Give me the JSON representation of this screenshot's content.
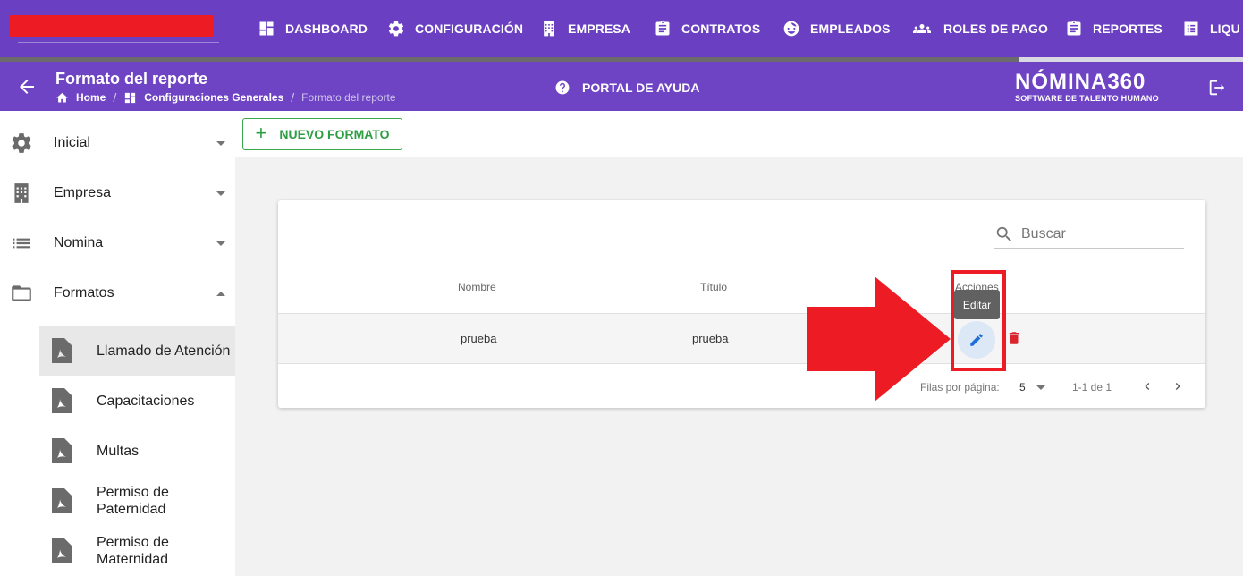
{
  "nav": {
    "items": [
      {
        "label": "DASHBOARD",
        "icon": "dashboard-icon"
      },
      {
        "label": "CONFIGURACIÓN",
        "icon": "gear-icon"
      },
      {
        "label": "EMPRESA",
        "icon": "building-icon"
      },
      {
        "label": "CONTRATOS",
        "icon": "clipboard-icon"
      },
      {
        "label": "EMPLEADOS",
        "icon": "face-icon"
      },
      {
        "label": "ROLES DE PAGO",
        "icon": "people-icon"
      },
      {
        "label": "REPORTES",
        "icon": "clipboard-icon"
      },
      {
        "label": "LIQU",
        "icon": "list-icon"
      }
    ],
    "progress": 0.82
  },
  "header": {
    "title": "Formato del reporte",
    "breadcrumb": [
      "Home",
      "Configuraciones Generales",
      "Formato del reporte"
    ],
    "help_label": "PORTAL DE AYUDA",
    "logo_main": "NÓMINA360",
    "logo_sub": "SOFTWARE DE TALENTO HUMANO"
  },
  "sidebar": {
    "items": [
      {
        "label": "Inicial",
        "icon": "gear-icon",
        "expanded": false
      },
      {
        "label": "Empresa",
        "icon": "building-icon",
        "expanded": false
      },
      {
        "label": "Nomina",
        "icon": "list-icon",
        "expanded": false
      },
      {
        "label": "Formatos",
        "icon": "folder-open-icon",
        "expanded": true
      }
    ],
    "subitems": [
      {
        "label": "Llamado de Atención",
        "icon": "pdf-icon",
        "active": true
      },
      {
        "label": "Capacitaciones",
        "icon": "pdf-icon"
      },
      {
        "label": "Multas",
        "icon": "pdf-icon"
      },
      {
        "label": "Permiso de Paternidad",
        "icon": "pdf-icon"
      },
      {
        "label": "Permiso de Maternidad",
        "icon": "pdf-icon"
      }
    ]
  },
  "toolbar": {
    "new_label": "NUEVO FORMATO"
  },
  "table": {
    "search_placeholder": "Buscar",
    "columns": [
      "Nombre",
      "Título",
      "Acciones"
    ],
    "rows": [
      {
        "nombre": "prueba",
        "titulo": "prueba"
      }
    ],
    "tooltip": "Editar",
    "rows_per_page_label": "Filas por página:",
    "rows_per_page": "5",
    "range": "1-1 de 1"
  },
  "colors": {
    "nav": "#6a3fc2",
    "accent_green": "#2e9e45",
    "annotation_red": "#ec1b24"
  }
}
